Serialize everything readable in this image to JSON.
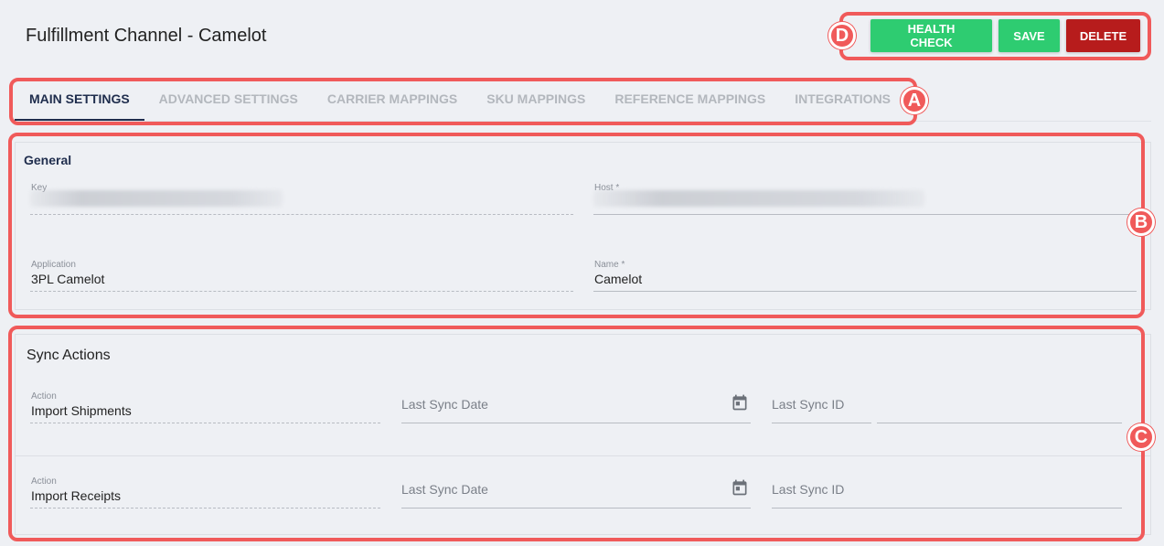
{
  "page": {
    "title": "Fulfillment Channel - Camelot"
  },
  "header_actions": {
    "health_check": "HEALTH CHECK",
    "save": "SAVE",
    "delete": "DELETE"
  },
  "tabs": [
    {
      "label": "MAIN SETTINGS",
      "active": true
    },
    {
      "label": "ADVANCED SETTINGS",
      "active": false
    },
    {
      "label": "CARRIER MAPPINGS",
      "active": false
    },
    {
      "label": "SKU MAPPINGS",
      "active": false
    },
    {
      "label": "REFERENCE MAPPINGS",
      "active": false
    },
    {
      "label": "INTEGRATIONS",
      "active": false
    }
  ],
  "general": {
    "title": "General",
    "key_label": "Key",
    "host_label": "Host *",
    "application_label": "Application",
    "application_value": "3PL Camelot",
    "name_label": "Name *",
    "name_value": "Camelot"
  },
  "sync": {
    "title": "Sync Actions",
    "rows": [
      {
        "action_label": "Action",
        "action_value": "Import Shipments",
        "date_label": "Last Sync Date",
        "id_label": "Last Sync ID"
      },
      {
        "action_label": "Action",
        "action_value": "Import Receipts",
        "date_label": "Last Sync Date",
        "id_label": "Last Sync ID"
      }
    ]
  },
  "annotations": {
    "a": "A",
    "b": "B",
    "c": "C",
    "d": "D"
  },
  "colors": {
    "accent_green": "#2ecc71",
    "danger_red": "#b71c1c",
    "tab_active": "#1f2d4d",
    "annotation": "#f05a5a"
  },
  "icons": {
    "calendar": "calendar-icon"
  }
}
